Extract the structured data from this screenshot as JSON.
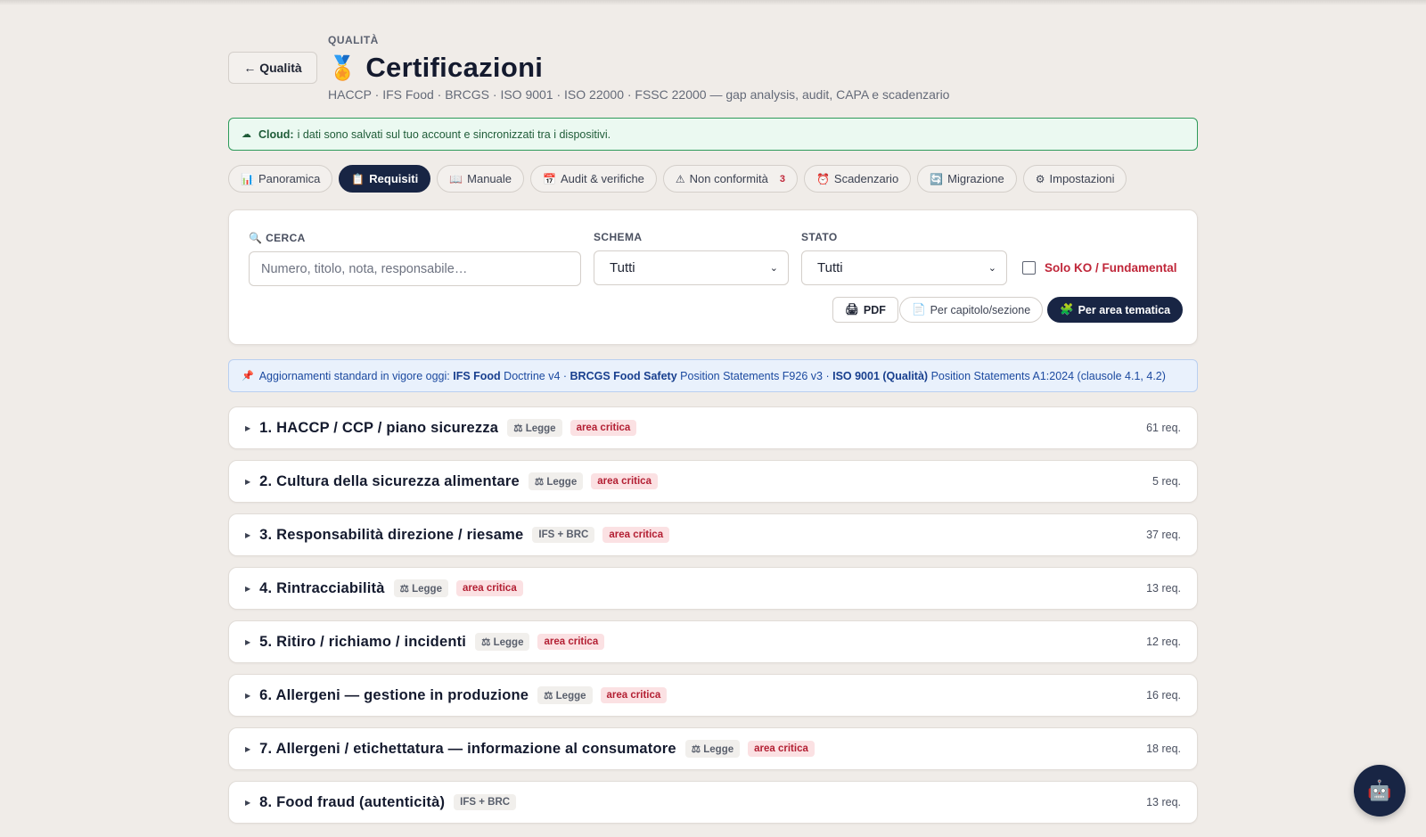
{
  "header": {
    "back_label": "← Qualità",
    "crumb": "QUALITÀ",
    "title_icon": "🏅",
    "title": "Certificazioni",
    "subtitle": "HACCP · IFS Food · BRCGS · ISO 9001 · ISO 22000 · FSSC 22000 — gap analysis, audit, CAPA e scadenzario"
  },
  "cloud": {
    "icon": "☁",
    "bold": "Cloud:",
    "text": "i dati sono salvati sul tuo account e sincronizzati tra i dispositivi."
  },
  "tabs": [
    {
      "icon": "📊",
      "label": "Panoramica",
      "active": false
    },
    {
      "icon": "📋",
      "label": "Requisiti",
      "active": true
    },
    {
      "icon": "📖",
      "label": "Manuale",
      "active": false
    },
    {
      "icon": "📅",
      "label": "Audit & verifiche",
      "active": false
    },
    {
      "icon": "⚠",
      "label": "Non conformità",
      "active": false,
      "count": "3"
    },
    {
      "icon": "⏰",
      "label": "Scadenzario",
      "active": false
    },
    {
      "icon": "🔄",
      "label": "Migrazione",
      "active": false
    },
    {
      "icon": "⚙",
      "label": "Impostazioni",
      "active": false
    }
  ],
  "filters": {
    "search_label": "CERCA",
    "search_placeholder": "Numero, titolo, nota, responsabile…",
    "schema_label": "SCHEMA",
    "schema_value": "Tutti",
    "stato_label": "STATO",
    "stato_value": "Tutti",
    "ko_label": "Solo KO / Fundamental",
    "pdf_label": "PDF",
    "chapter_label": "Per capitolo/sezione",
    "area_label": "Per area tematica"
  },
  "notice": {
    "icon": "📌",
    "prefix": "Aggiornamenti standard in vigore oggi:",
    "s1_bold": "IFS Food",
    "s1_text": "Doctrine v4 ·",
    "s2_bold": "BRCGS Food Safety",
    "s2_text": "Position Statements F926 v3 ·",
    "s3_bold": "ISO 9001 (Qualità)",
    "s3_text": "Position Statements A1:2024 (clausole 4.1, 4.2)"
  },
  "chapters": [
    {
      "title": "1. HACCP / CCP / piano sicurezza",
      "tag": "⚖ Legge",
      "critical": "area critica",
      "req": "61 req."
    },
    {
      "title": "2. Cultura della sicurezza alimentare",
      "tag": "⚖ Legge",
      "critical": "area critica",
      "req": "5 req."
    },
    {
      "title": "3. Responsabilità direzione / riesame",
      "tag": "IFS + BRC",
      "critical": "area critica",
      "req": "37 req."
    },
    {
      "title": "4. Rintracciabilità",
      "tag": "⚖ Legge",
      "critical": "area critica",
      "req": "13 req."
    },
    {
      "title": "5. Ritiro / richiamo / incidenti",
      "tag": "⚖ Legge",
      "critical": "area critica",
      "req": "12 req."
    },
    {
      "title": "6. Allergeni — gestione in produzione",
      "tag": "⚖ Legge",
      "critical": "area critica",
      "req": "16 req."
    },
    {
      "title": "7. Allergeni / etichettatura — informazione al consumatore",
      "tag": "⚖ Legge",
      "critical": "area critica",
      "req": "18 req."
    },
    {
      "title": "8. Food fraud (autenticità)",
      "tag": "IFS + BRC",
      "critical": "",
      "req": "13 req."
    }
  ],
  "assistant": {
    "icon": "🤖"
  }
}
